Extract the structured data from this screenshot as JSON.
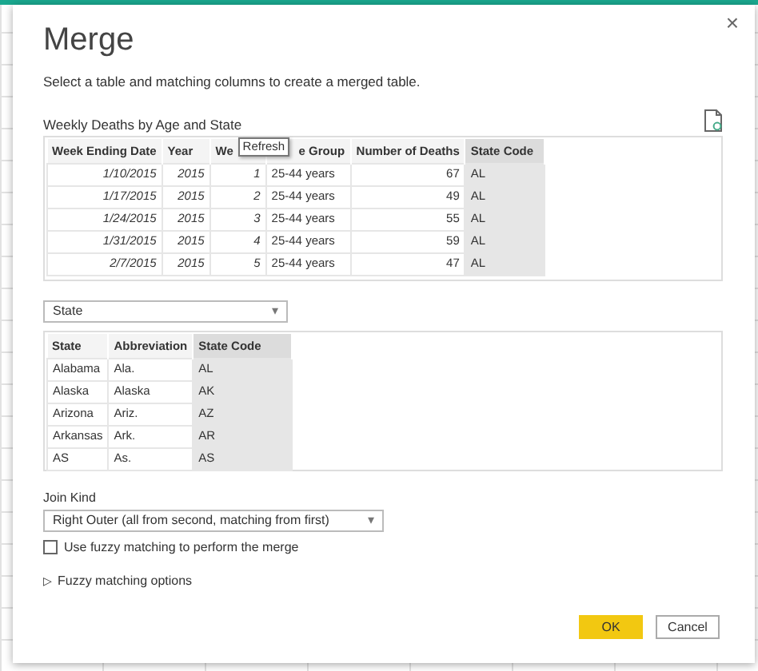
{
  "dialog": {
    "title": "Merge",
    "close": "×",
    "description": "Select a table and matching columns to create a merged table.",
    "first_table": {
      "name": "Weekly Deaths by Age and State",
      "columns": [
        {
          "label": "Week Ending Date",
          "kind": "formatted",
          "selected": false
        },
        {
          "label": "Year",
          "kind": "formatted",
          "selected": false
        },
        {
          "label": "We",
          "kind": "formatted",
          "selected": false
        },
        {
          "label": "e Group",
          "kind": "text",
          "selected": false
        },
        {
          "label": "Number of Deaths",
          "kind": "number",
          "selected": false
        },
        {
          "label": "State Code",
          "kind": "text",
          "selected": true
        }
      ],
      "rows": [
        [
          "1/10/2015",
          "2015",
          "1",
          "25-44 years",
          "67",
          "AL"
        ],
        [
          "1/17/2015",
          "2015",
          "2",
          "25-44 years",
          "49",
          "AL"
        ],
        [
          "1/24/2015",
          "2015",
          "3",
          "25-44 years",
          "55",
          "AL"
        ],
        [
          "1/31/2015",
          "2015",
          "4",
          "25-44 years",
          "59",
          "AL"
        ],
        [
          "2/7/2015",
          "2015",
          "5",
          "25-44 years",
          "47",
          "AL"
        ]
      ],
      "tooltip": "Refresh"
    },
    "second_table": {
      "selector": "State",
      "arrow": "▾",
      "columns": [
        {
          "label": "State",
          "selected": false
        },
        {
          "label": "Abbreviation",
          "selected": false
        },
        {
          "label": "State Code",
          "selected": true
        }
      ],
      "rows": [
        [
          "Alabama",
          "Ala.",
          "AL"
        ],
        [
          "Alaska",
          "Alaska",
          "AK"
        ],
        [
          "Arizona",
          "Ariz.",
          "AZ"
        ],
        [
          "Arkansas",
          "Ark.",
          "AR"
        ],
        [
          "AS",
          "As.",
          "AS"
        ]
      ]
    },
    "join_kind": {
      "label": "Join Kind",
      "value": "Right Outer (all from second, matching from first)",
      "arrow": "▾"
    },
    "fuzzy": {
      "label": "Use fuzzy matching to perform the merge",
      "checked": false
    },
    "fuzzy_options": {
      "icon": "▷",
      "label": "Fuzzy matching options",
      "expanded": false
    },
    "buttons": [
      {
        "label": "OK",
        "primary": true
      },
      {
        "label": "Cancel",
        "primary": false
      }
    ]
  }
}
